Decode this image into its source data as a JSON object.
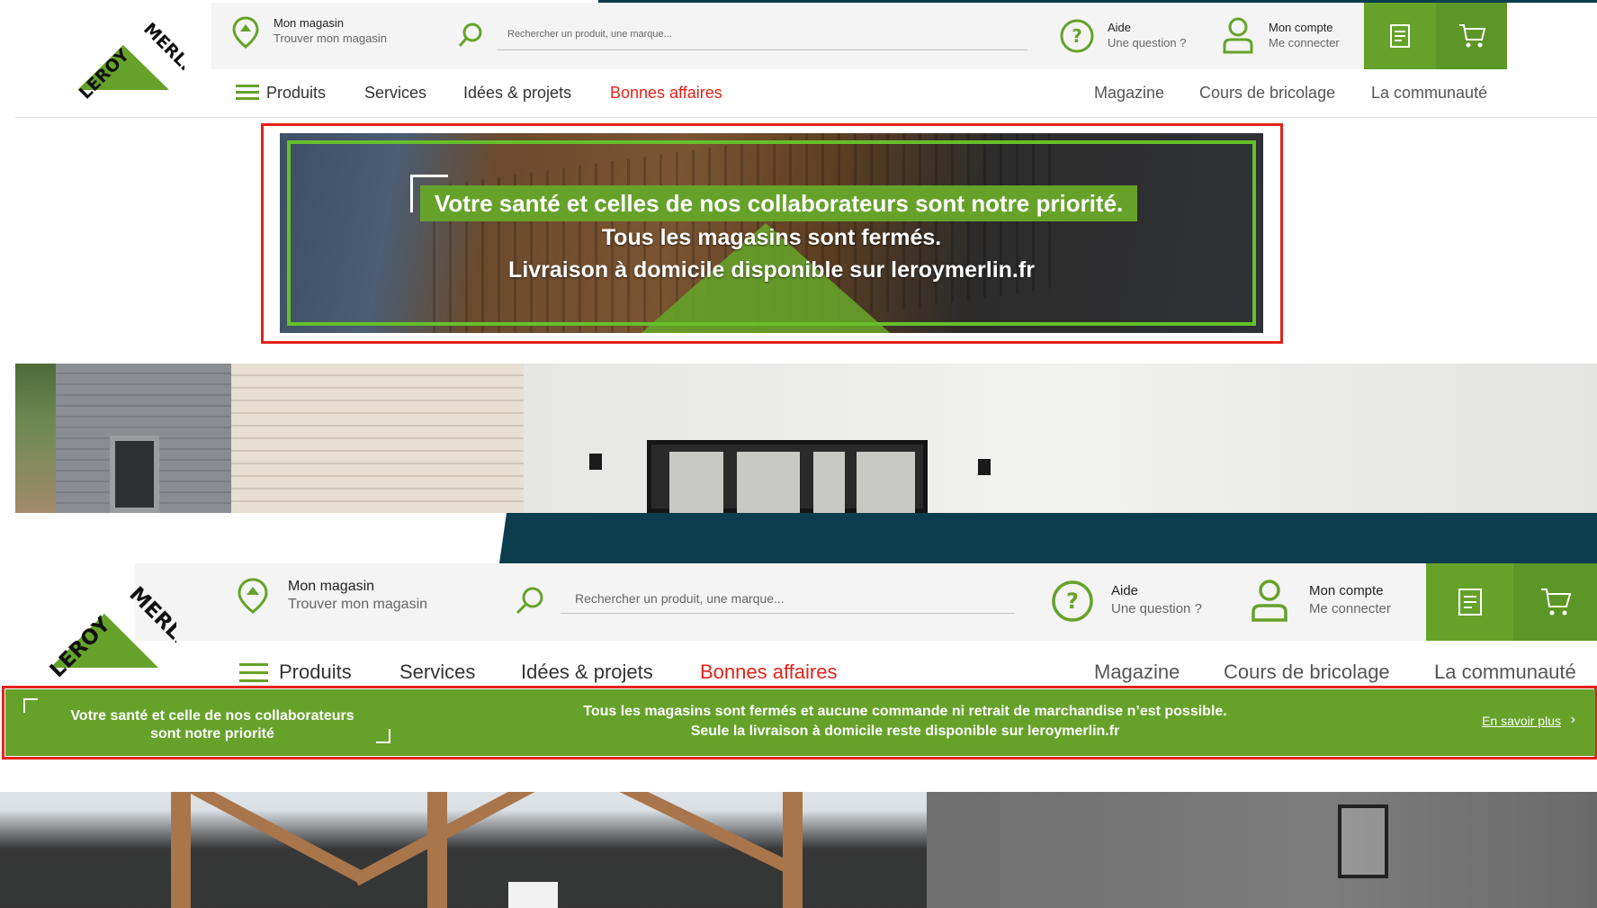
{
  "brand": {
    "logo_text": "LEROY MERLIN",
    "green": "#66a22a",
    "red": "#e2231a",
    "navy": "#0b3d4f"
  },
  "header": {
    "store_title": "Mon magasin",
    "store_sub": "Trouver mon magasin",
    "search_placeholder": "Rechercher un produit, une marque...",
    "help_title": "Aide",
    "help_sub": "Une question ?",
    "account_title": "Mon compte",
    "account_sub": "Me connecter",
    "icons": {
      "store": "location-pin-icon",
      "search": "search-icon",
      "help": "help-circle-icon",
      "account": "user-icon",
      "list": "shopping-list-icon",
      "cart": "cart-icon",
      "menu": "hamburger-icon"
    }
  },
  "nav": {
    "products": "Produits",
    "services": "Services",
    "ideas": "Idées & projets",
    "deals": "Bonnes affaires",
    "magazine": "Magazine",
    "courses": "Cours de bricolage",
    "community": "La communauté"
  },
  "banner_old": {
    "headline": "Votre santé et celles de nos collaborateurs sont notre priorité.",
    "line2": "Tous les magasins sont fermés.",
    "line3": "Livraison à domicile disponible sur leroymerlin.fr"
  },
  "banner_new": {
    "left_line1": "Votre santé et celle de nos collaborateurs",
    "left_line2": "sont notre priorité",
    "mid_line1": "Tous les magasins sont fermés et aucune commande ni retrait de marchandise n’est possible.",
    "mid_line2": "Seule la livraison à domicile reste disponible sur leroymerlin.fr",
    "more_link": "En savoir plus",
    "more_arrow": "›"
  }
}
